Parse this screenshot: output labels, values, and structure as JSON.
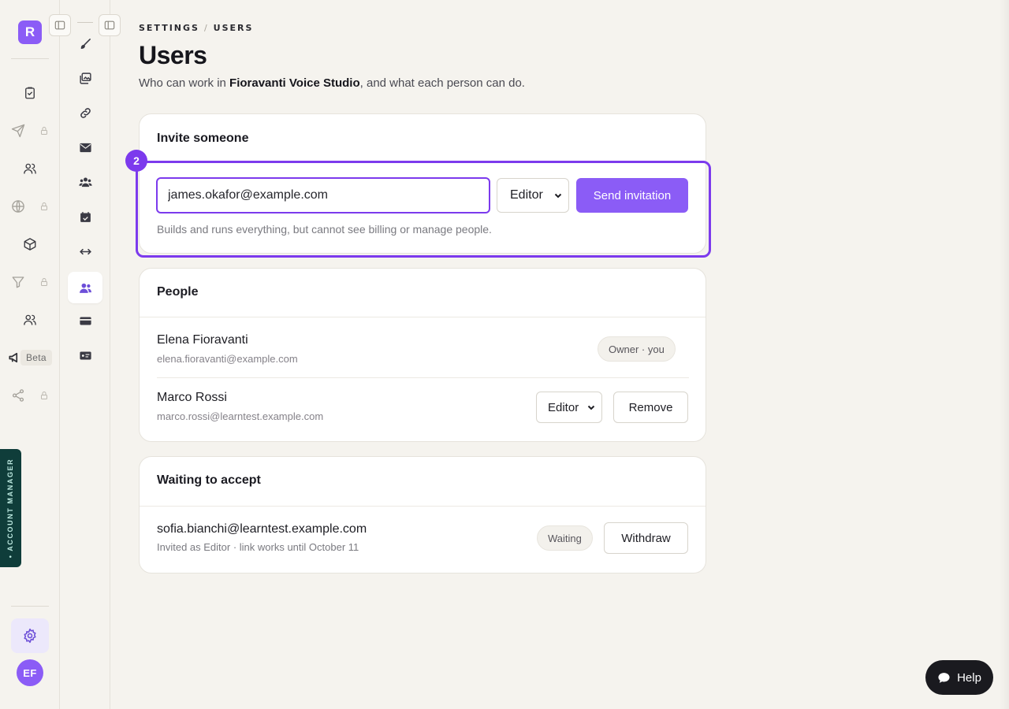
{
  "app": {
    "logo_letter": "R",
    "accent": "#8b5cf6",
    "highlight": "#7c3aed"
  },
  "rail": {
    "items": [
      {
        "icon": "clipboard-check-icon",
        "locked": false
      },
      {
        "icon": "send-icon",
        "locked": true
      },
      {
        "icon": "users-icon",
        "locked": false
      },
      {
        "icon": "globe-icon",
        "locked": true
      },
      {
        "icon": "package-icon",
        "locked": false
      },
      {
        "icon": "filter-icon",
        "locked": true
      },
      {
        "icon": "team-icon",
        "locked": false
      },
      {
        "icon": "megaphone-icon",
        "badge": "Beta"
      },
      {
        "icon": "share-icon",
        "locked": true
      }
    ],
    "account_manager_label": "• ACCOUNT MANAGER",
    "avatar_initials": "EF"
  },
  "subnav": {
    "items": [
      {
        "icon": "brush-icon"
      },
      {
        "icon": "images-icon"
      },
      {
        "icon": "link-icon"
      },
      {
        "icon": "mail-icon"
      },
      {
        "icon": "team-icon"
      },
      {
        "icon": "calendar-icon"
      },
      {
        "icon": "arrows-horizontal-icon"
      },
      {
        "icon": "users-icon",
        "active": true
      },
      {
        "icon": "credit-card-icon"
      },
      {
        "icon": "id-card-icon"
      }
    ]
  },
  "header": {
    "breadcrumb": [
      "SETTINGS",
      "USERS"
    ],
    "title": "Users",
    "subtitle_prefix": "Who can work in ",
    "subtitle_workspace": "Fioravanti Voice Studio",
    "subtitle_suffix": ", and what each person can do."
  },
  "invite": {
    "title": "Invite someone",
    "step": "2",
    "email_value": "james.okafor@example.com",
    "role_value": "Editor",
    "send_label": "Send invitation",
    "hint": "Builds and runs everything, but cannot see billing or manage people."
  },
  "people": {
    "title": "People",
    "rows": [
      {
        "name": "Elena Fioravanti",
        "email": "elena.fioravanti@example.com",
        "badge": "Owner · you"
      },
      {
        "name": "Marco Rossi",
        "email": "marco.rossi@learntest.example.com",
        "role": "Editor",
        "remove_label": "Remove"
      }
    ]
  },
  "waiting": {
    "title": "Waiting to accept",
    "rows": [
      {
        "email": "sofia.bianchi@learntest.example.com",
        "detail": "Invited as Editor · link works until October 11",
        "status": "Waiting",
        "withdraw_label": "Withdraw"
      }
    ]
  },
  "help": {
    "label": "Help"
  }
}
